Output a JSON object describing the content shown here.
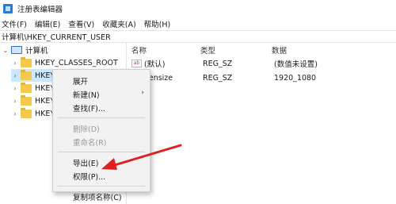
{
  "window": {
    "title": "注册表编辑器"
  },
  "menubar": {
    "items": [
      "文件(F)",
      "编辑(E)",
      "查看(V)",
      "收藏夹(A)",
      "帮助(H)"
    ]
  },
  "address": {
    "path": "计算机\\HKEY_CURRENT_USER"
  },
  "tree": {
    "root_label": "计算机",
    "items": [
      "HKEY_CLASSES_ROOT",
      "HKEY_CURRENT_USER",
      "HKEY",
      "HKEY",
      "HKEY"
    ]
  },
  "list": {
    "headers": {
      "name": "名称",
      "type": "类型",
      "data": "数据"
    },
    "rows": [
      {
        "name": "(默认)",
        "type": "REG_SZ",
        "data": "(数值未设置)"
      },
      {
        "name": "eensize",
        "type": "REG_SZ",
        "data": "1920_1080"
      }
    ],
    "ab_icon_text": "ab"
  },
  "context_menu": {
    "items": [
      {
        "label": "展开",
        "disabled": false
      },
      {
        "label": "新建(N)",
        "disabled": false,
        "has_submenu": true
      },
      {
        "label": "查找(F)...",
        "disabled": false
      },
      {
        "label": "删除(D)",
        "disabled": true
      },
      {
        "label": "重命名(R)",
        "disabled": true
      },
      {
        "label": "导出(E)",
        "disabled": false
      },
      {
        "label": "权限(P)...",
        "disabled": false
      },
      {
        "label": "复制项名称(C)",
        "disabled": false
      }
    ],
    "submenu_glyph": "›"
  },
  "annotation": {
    "arrow_color": "#e02020"
  }
}
